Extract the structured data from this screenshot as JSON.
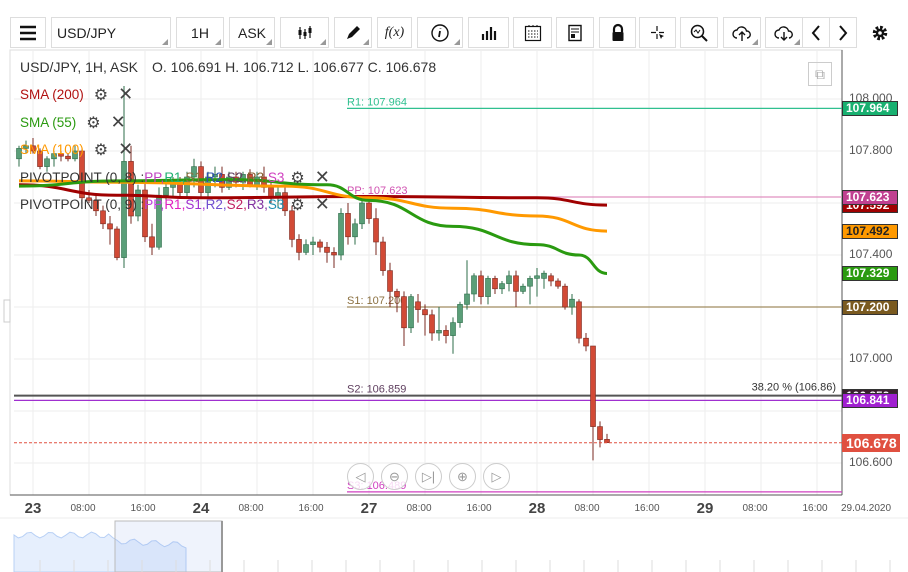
{
  "toolbar": {
    "symbol": "USD/JPY",
    "timeframe": "1H",
    "price_type": "ASK",
    "function_label": "f(x)",
    "icons": [
      "menu-icon",
      "candlestick-icon",
      "pencil-icon",
      "function-icon",
      "info-icon",
      "bar-chart-icon",
      "calendar-icon",
      "document-icon",
      "lock-icon",
      "crosshair-icon",
      "zoom-chart-icon",
      "cloud-upload-icon",
      "cloud-download-icon",
      "chevron-left-icon",
      "chevron-right-icon",
      "gear-icon"
    ]
  },
  "legend": {
    "title": "USD/JPY, 1H, ASK",
    "ohlc": "O. 106.691 H. 106.712 L. 106.677 C. 106.678",
    "indicators": [
      {
        "label": "SMA (200)",
        "color": "#b01010"
      },
      {
        "label": "SMA (55)",
        "color": "#2a9a10"
      },
      {
        "label": "SMA (100)",
        "color": "#ff9900"
      }
    ],
    "pivot1": {
      "label": "PIVOTPOINT (0, 8)",
      "parts": [
        {
          "t": "PP",
          "c": "#c040c0"
        },
        {
          "t": "R1",
          "c": "#20b070"
        },
        {
          "t": "S1",
          "c": "#8b7040"
        },
        {
          "t": "R2",
          "c": "#3050b0"
        },
        {
          "t": "S2",
          "c": "#604060"
        },
        {
          "t": "R3",
          "c": "#8b6030"
        },
        {
          "t": "S3",
          "c": "#d040c0"
        }
      ]
    },
    "pivot2": {
      "label": "PIVOTPOINT (0, 9)",
      "parts": [
        {
          "t": "PP",
          "c": "#c040e0"
        },
        {
          "t": "R1",
          "c": "#e020c0"
        },
        {
          "t": "S1",
          "c": "#a030d0"
        },
        {
          "t": "R2",
          "c": "#7050d0"
        },
        {
          "t": "S2",
          "c": "#c02060"
        },
        {
          "t": "R3",
          "c": "#8030a0"
        },
        {
          "t": "S3",
          "c": "#2090b0"
        }
      ]
    }
  },
  "chart_data": {
    "type": "candlestick",
    "ylim": [
      106.5,
      108.2
    ],
    "y_ticks": [
      "108.000",
      "107.800",
      "107.400",
      "107.000",
      "106.600"
    ],
    "x_ticks": [
      {
        "t": "23",
        "day": true
      },
      {
        "t": "08:00"
      },
      {
        "t": "16:00"
      },
      {
        "t": "24",
        "day": true
      },
      {
        "t": "08:00"
      },
      {
        "t": "16:00"
      },
      {
        "t": "27",
        "day": true
      },
      {
        "t": "08:00"
      },
      {
        "t": "16:00"
      },
      {
        "t": "28",
        "day": true
      },
      {
        "t": "08:00"
      },
      {
        "t": "16:00"
      },
      {
        "t": "29",
        "day": true
      },
      {
        "t": "08:00"
      },
      {
        "t": "16:00"
      },
      {
        "t": "29.04.2020"
      }
    ],
    "candles": [
      [
        "22 22:00",
        107.77,
        107.82,
        107.74,
        107.81
      ],
      [
        "22 23:00",
        107.81,
        107.84,
        107.79,
        107.82
      ],
      [
        "23 00:00",
        107.82,
        107.85,
        107.79,
        107.8
      ],
      [
        "23 01:00",
        107.8,
        107.81,
        107.73,
        107.74
      ],
      [
        "23 02:00",
        107.74,
        107.78,
        107.72,
        107.77
      ],
      [
        "23 03:00",
        107.77,
        107.8,
        107.74,
        107.79
      ],
      [
        "23 04:00",
        107.79,
        107.8,
        107.76,
        107.78
      ],
      [
        "23 05:00",
        107.78,
        107.79,
        107.76,
        107.77
      ],
      [
        "23 06:00",
        107.77,
        107.82,
        107.76,
        107.8
      ],
      [
        "23 07:00",
        107.8,
        107.81,
        107.6,
        107.62
      ],
      [
        "23 08:00",
        107.62,
        107.65,
        107.6,
        107.61
      ],
      [
        "23 09:00",
        107.61,
        107.63,
        107.55,
        107.57
      ],
      [
        "23 10:00",
        107.57,
        107.59,
        107.5,
        107.52
      ],
      [
        "23 11:00",
        107.52,
        107.55,
        107.44,
        107.5
      ],
      [
        "23 12:00",
        107.5,
        107.51,
        107.38,
        107.39
      ],
      [
        "23 13:00",
        107.39,
        108.05,
        107.35,
        107.76
      ],
      [
        "23 14:00",
        107.76,
        107.82,
        107.52,
        107.55
      ],
      [
        "23 15:00",
        107.55,
        107.67,
        107.53,
        107.65
      ],
      [
        "23 16:00",
        107.65,
        107.68,
        107.45,
        107.47
      ],
      [
        "23 17:00",
        107.47,
        107.52,
        107.4,
        107.43
      ],
      [
        "23 18:00",
        107.43,
        107.66,
        107.42,
        107.63
      ],
      [
        "23 19:00",
        107.63,
        107.7,
        107.6,
        107.66
      ],
      [
        "23 20:00",
        107.66,
        107.7,
        107.62,
        107.68
      ],
      [
        "23 21:00",
        107.68,
        107.7,
        107.62,
        107.64
      ],
      [
        "23 22:00",
        107.64,
        107.72,
        107.62,
        107.7
      ],
      [
        "23 23:00",
        107.7,
        107.77,
        107.66,
        107.74
      ],
      [
        "24 00:00",
        107.74,
        107.76,
        107.62,
        107.64
      ],
      [
        "24 01:00",
        107.64,
        107.72,
        107.62,
        107.7
      ],
      [
        "24 02:00",
        107.7,
        107.74,
        107.66,
        107.71
      ],
      [
        "24 03:00",
        107.71,
        107.74,
        107.64,
        107.66
      ],
      [
        "24 04:00",
        107.66,
        107.72,
        107.65,
        107.7
      ],
      [
        "24 05:00",
        107.7,
        107.72,
        107.66,
        107.68
      ],
      [
        "24 06:00",
        107.68,
        107.72,
        107.65,
        107.71
      ],
      [
        "24 07:00",
        107.71,
        107.73,
        107.66,
        107.67
      ],
      [
        "24 08:00",
        107.67,
        107.72,
        107.65,
        107.7
      ],
      [
        "24 09:00",
        107.7,
        107.74,
        107.64,
        107.66
      ],
      [
        "24 10:00",
        107.66,
        107.68,
        107.6,
        107.62
      ],
      [
        "24 11:00",
        107.62,
        107.66,
        107.58,
        107.64
      ],
      [
        "24 12:00",
        107.64,
        107.66,
        107.55,
        107.57
      ],
      [
        "24 13:00",
        107.57,
        107.59,
        107.43,
        107.46
      ],
      [
        "24 14:00",
        107.46,
        107.48,
        107.38,
        107.41
      ],
      [
        "24 15:00",
        107.41,
        107.46,
        107.4,
        107.44
      ],
      [
        "24 16:00",
        107.44,
        107.47,
        107.4,
        107.45
      ],
      [
        "24 17:00",
        107.45,
        107.46,
        107.41,
        107.43
      ],
      [
        "24 18:00",
        107.43,
        107.45,
        107.37,
        107.41
      ],
      [
        "24 19:00",
        107.41,
        107.43,
        107.35,
        107.4
      ],
      [
        "24 20:00",
        107.4,
        107.58,
        107.38,
        107.56
      ],
      [
        "24 21:00",
        107.56,
        107.6,
        107.44,
        107.47
      ],
      [
        "24 22:00",
        107.47,
        107.54,
        107.44,
        107.52
      ],
      [
        "24 23:00",
        107.52,
        107.62,
        107.5,
        107.6
      ],
      [
        "27 00:00",
        107.6,
        107.62,
        107.52,
        107.54
      ],
      [
        "27 01:00",
        107.54,
        107.58,
        107.4,
        107.45
      ],
      [
        "27 02:00",
        107.45,
        107.47,
        107.32,
        107.34
      ],
      [
        "27 03:00",
        107.34,
        107.37,
        107.2,
        107.26
      ],
      [
        "27 04:00",
        107.26,
        107.27,
        107.18,
        107.24
      ],
      [
        "27 05:00",
        107.24,
        107.26,
        107.05,
        107.12
      ],
      [
        "27 06:00",
        107.12,
        107.25,
        107.1,
        107.24
      ],
      [
        "27 07:00",
        107.22,
        107.25,
        107.14,
        107.19
      ],
      [
        "27 08:00",
        107.19,
        107.21,
        107.09,
        107.17
      ],
      [
        "27 09:00",
        107.17,
        107.19,
        107.07,
        107.1
      ],
      [
        "27 10:00",
        107.1,
        107.2,
        107.07,
        107.11
      ],
      [
        "27 11:00",
        107.11,
        107.13,
        107.06,
        107.09
      ],
      [
        "27 12:00",
        107.09,
        107.16,
        107.02,
        107.14
      ],
      [
        "27 13:00",
        107.14,
        107.22,
        107.12,
        107.21
      ],
      [
        "27 14:00",
        107.21,
        107.38,
        107.19,
        107.25
      ],
      [
        "27 15:00",
        107.25,
        107.33,
        107.22,
        107.32
      ],
      [
        "27 16:00",
        107.32,
        107.34,
        107.21,
        107.24
      ],
      [
        "27 17:00",
        107.24,
        107.32,
        107.21,
        107.31
      ],
      [
        "27 18:00",
        107.31,
        107.32,
        107.25,
        107.27
      ],
      [
        "27 19:00",
        107.27,
        107.3,
        107.25,
        107.29
      ],
      [
        "27 20:00",
        107.29,
        107.34,
        107.26,
        107.32
      ],
      [
        "27 21:00",
        107.32,
        107.34,
        107.2,
        107.26
      ],
      [
        "27 22:00",
        107.26,
        107.29,
        107.25,
        107.28
      ],
      [
        "27 23:00",
        107.28,
        107.32,
        107.21,
        107.31
      ],
      [
        "28 00:00",
        107.31,
        107.35,
        107.24,
        107.32
      ],
      [
        "28 01:00",
        107.31,
        107.34,
        107.27,
        107.33
      ],
      [
        "28 02:00",
        107.32,
        107.33,
        107.28,
        107.3
      ],
      [
        "28 03:00",
        107.3,
        107.31,
        107.27,
        107.28
      ],
      [
        "28 04:00",
        107.28,
        107.29,
        107.19,
        107.2
      ],
      [
        "28 05:00",
        107.2,
        107.25,
        107.17,
        107.23
      ],
      [
        "28 06:00",
        107.22,
        107.23,
        107.06,
        107.08
      ],
      [
        "28 07:00",
        107.08,
        107.1,
        107.03,
        107.05
      ],
      [
        "28 08:00",
        107.05,
        107.05,
        106.61,
        106.74
      ],
      [
        "28 09:00",
        106.74,
        106.76,
        106.66,
        106.69
      ],
      [
        "28 10:00",
        106.691,
        106.712,
        106.677,
        106.678
      ]
    ],
    "sma": [
      {
        "name": "SMA (200)",
        "color": "#a00000",
        "points": [
          [
            "22 22:00",
            107.67
          ],
          [
            "23 12:00",
            107.63
          ],
          [
            "24 00:00",
            107.62
          ],
          [
            "27 00:00",
            107.625
          ],
          [
            "28 00:00",
            107.62
          ],
          [
            "28 10:00",
            107.592
          ]
        ]
      },
      {
        "name": "SMA (100)",
        "color": "#ff9900",
        "points": [
          [
            "22 22:00",
            107.685
          ],
          [
            "23 12:00",
            107.68
          ],
          [
            "24 12:00",
            107.665
          ],
          [
            "27 00:00",
            107.62
          ],
          [
            "27 12:00",
            107.58
          ],
          [
            "28 00:00",
            107.55
          ],
          [
            "28 10:00",
            107.492
          ]
        ]
      },
      {
        "name": "SMA (55)",
        "color": "#2a9a10",
        "points": [
          [
            "22 22:00",
            107.665
          ],
          [
            "23 12:00",
            107.685
          ],
          [
            "24 04:00",
            107.69
          ],
          [
            "24 18:00",
            107.67
          ],
          [
            "27 00:00",
            107.61
          ],
          [
            "27 12:00",
            107.51
          ],
          [
            "28 00:00",
            107.44
          ],
          [
            "28 06:00",
            107.4
          ],
          [
            "28 10:00",
            107.329
          ]
        ]
      }
    ],
    "levels": [
      {
        "label": "R1: 107.964",
        "value": 107.964,
        "color": "#30c090",
        "from": "27 00:00"
      },
      {
        "label": "PP: 107.623",
        "value": 107.623,
        "color": "#e090c0",
        "from": "27 00:00",
        "text_color": "#d050b0"
      },
      {
        "label": "S1: 107.200",
        "value": 107.2,
        "color": "#a08c60",
        "from": "27 00:00",
        "text_color": "#8b7040"
      },
      {
        "label": "S2: 106.859",
        "value": 106.859,
        "color": "#555555",
        "from": "22 22:00",
        "text_color": "#604060",
        "label_at": "27 00:00"
      },
      {
        "label": "",
        "value": 106.841,
        "color": "#a030d0",
        "from": "22 22:00"
      },
      {
        "label": "S3: 106.489",
        "value": 106.489,
        "color": "#d040c0",
        "from": "27 00:00",
        "text_color": "#d040c0"
      }
    ],
    "fib_label": "38.20 % (106.86)",
    "current_price": {
      "value": 106.678,
      "label": "106.678",
      "color": "#e05040"
    },
    "price_labels": [
      {
        "label": "107.964",
        "value": 107.964,
        "bg": "#18b070"
      },
      {
        "label": "107.592",
        "value": 107.592,
        "bg": "#a00000"
      },
      {
        "label": "107.623",
        "value": 107.623,
        "bg": "#c04090"
      },
      {
        "label": "107.492",
        "value": 107.492,
        "bg": "#ff9900",
        "fg": "#222"
      },
      {
        "label": "107.329",
        "value": 107.329,
        "bg": "#2a9a10"
      },
      {
        "label": "107.200",
        "value": 107.2,
        "bg": "#7a5a20"
      },
      {
        "label": "106.859",
        "value": 106.859,
        "bg": "#3a2030"
      },
      {
        "label": "106.841",
        "value": 106.841,
        "bg": "#a020d0"
      }
    ]
  }
}
